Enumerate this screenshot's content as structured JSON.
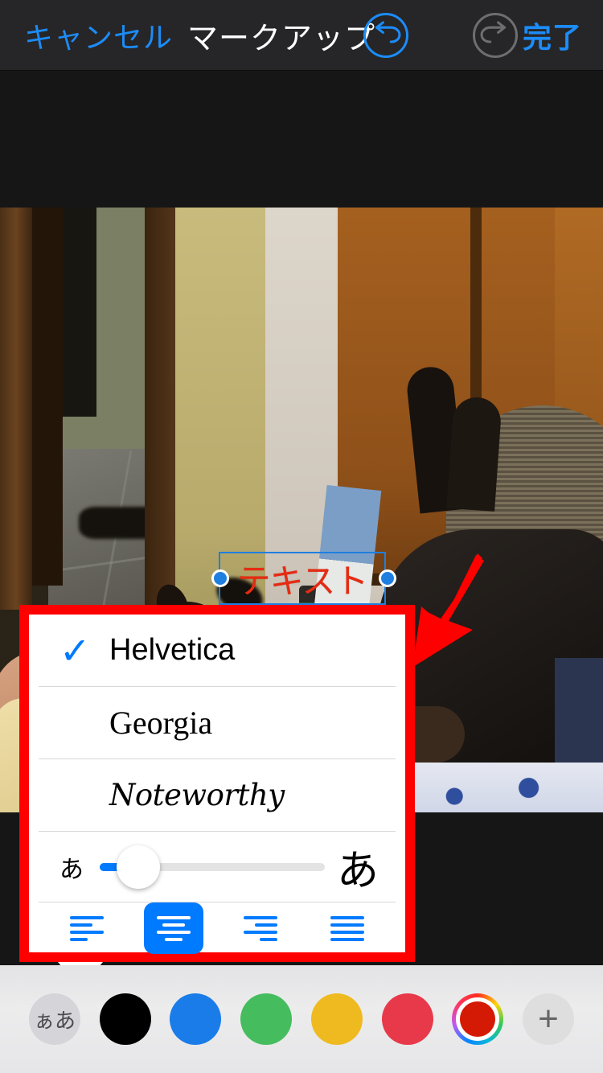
{
  "navbar": {
    "cancel_label": "キャンセル",
    "title": "マークアップ",
    "undo_icon": "undo-arrow-icon",
    "redo_icon": "redo-arrow-icon",
    "done_label": "完了",
    "accent_color": "#1c8cf8",
    "disabled_color": "#6e6e72"
  },
  "canvas": {
    "letterbox_color": "#161617",
    "annotation": {
      "textbox": {
        "value": "テキスト",
        "text_color": "#e62b12",
        "selection_border_color": "#1f7fe0",
        "handle_color": "#1f7fe0"
      },
      "arrow": {
        "icon": "red-arrow-annotation-icon",
        "color": "#ff0000"
      }
    }
  },
  "popover": {
    "highlight_color": "#ff0000",
    "background": "#ffffff",
    "fonts": [
      {
        "name": "Helvetica",
        "selected": true,
        "check_glyph": "✓"
      },
      {
        "name": "Georgia",
        "selected": false,
        "check_glyph": ""
      },
      {
        "name": "Noteworthy",
        "selected": false,
        "check_glyph": ""
      }
    ],
    "size_slider": {
      "small_glyph": "あ",
      "large_glyph": "あ",
      "value_percent": 17,
      "fill_color": "#007aff"
    },
    "alignment": [
      {
        "id": "left",
        "icon": "align-left-icon",
        "selected": false
      },
      {
        "id": "center",
        "icon": "align-center-icon",
        "selected": true
      },
      {
        "id": "right",
        "icon": "align-right-icon",
        "selected": false
      },
      {
        "id": "justify",
        "icon": "align-justify-icon",
        "selected": false
      }
    ],
    "selected_color": "#007aff"
  },
  "bottom_bar": {
    "text_format": {
      "label": "ぁあ",
      "icon": "text-format-icon",
      "background": "#d5d4d9"
    },
    "colors": [
      {
        "name": "black",
        "hex": "#000000",
        "selected": false
      },
      {
        "name": "blue",
        "hex": "#1a7ce8",
        "selected": false
      },
      {
        "name": "green",
        "hex": "#45bd5e",
        "selected": false
      },
      {
        "name": "yellow",
        "hex": "#eeba20",
        "selected": false
      },
      {
        "name": "red",
        "hex": "#e8394b",
        "selected": false
      }
    ],
    "color_wheel": {
      "icon": "color-wheel-icon",
      "current_hex": "#d41a05",
      "selected": true
    },
    "add_button": {
      "icon": "plus-icon",
      "label": "+"
    }
  }
}
